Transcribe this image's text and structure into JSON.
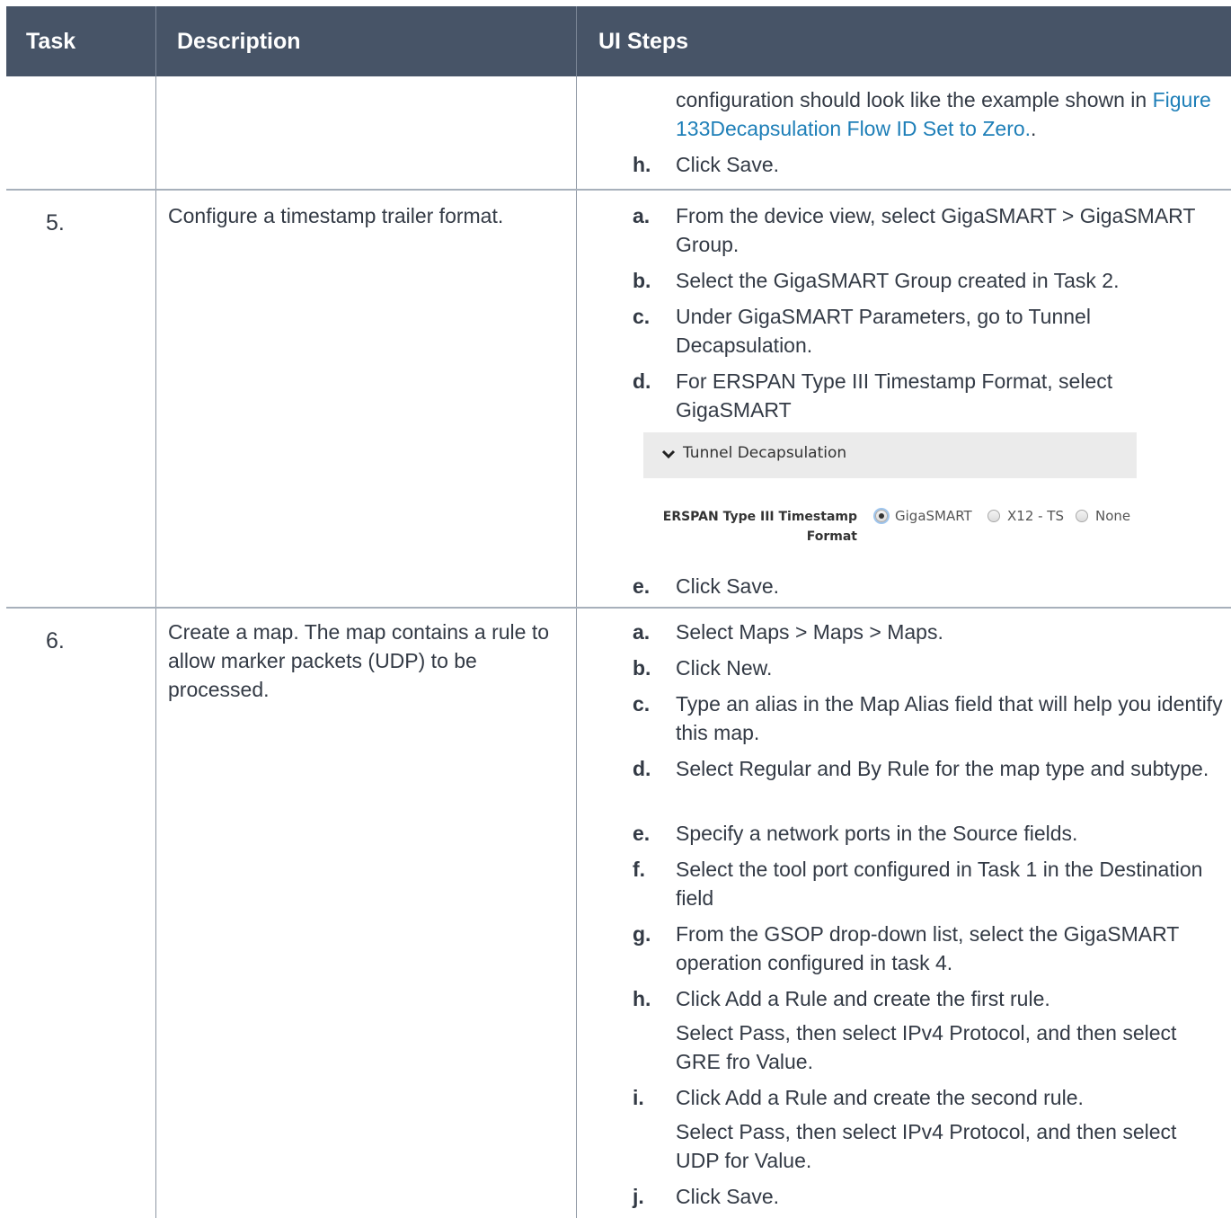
{
  "header": {
    "task": "Task",
    "description": "Description",
    "ui_steps": "UI Steps"
  },
  "continuation": {
    "text_before_link": "configuration should look like the example shown in ",
    "link": "Figure 133Decapsulation Flow ID Set to Zero.",
    "text_after_link": ".",
    "step_h": {
      "letter": "h.",
      "text": "Click Save."
    }
  },
  "row5": {
    "number": "5.",
    "description": "Configure a timestamp trailer format.",
    "steps": [
      {
        "letter": "a.",
        "text": "From the device view, select GigaSMART > GigaSMART Group."
      },
      {
        "letter": "b.",
        "text": "Select the GigaSMART Group created in Task 2."
      },
      {
        "letter": "c.",
        "text": "Under GigaSMART Parameters, go to Tunnel Decapsulation."
      },
      {
        "letter": "d.",
        "text": "For ERSPAN Type III Timestamp Format, select GigaSMART"
      }
    ],
    "screenshot": {
      "section_title": "Tunnel Decapsulation",
      "field_label": "ERSPAN Type III Timestamp Format",
      "options": [
        "GigaSMART",
        "X12 - TS",
        "None"
      ],
      "selected": "GigaSMART"
    },
    "step_e": {
      "letter": "e.",
      "text": "Click Save."
    }
  },
  "row6": {
    "number": "6.",
    "description": "Create a map. The map contains a rule to allow marker packets (UDP) to be processed.",
    "steps": [
      {
        "letter": "a.",
        "text": "Select Maps > Maps > Maps."
      },
      {
        "letter": "b.",
        "text": "Click New."
      },
      {
        "letter": "c.",
        "text": "Type an alias in the Map Alias field that will help you identify this map."
      },
      {
        "letter": "d.",
        "text": "Select Regular and By Rule for the map type and subtype."
      },
      {
        "letter": "e.",
        "text": "Specify a network ports in the Source fields."
      },
      {
        "letter": "f.",
        "text": "Select the tool port configured in Task 1 in the Destination field"
      },
      {
        "letter": "g.",
        "text": "From the GSOP drop-down list, select the GigaSMART operation configured in task 4."
      },
      {
        "letter": "h.",
        "text": "Click Add a Rule and create the first rule.",
        "sub": "Select Pass, then select IPv4 Protocol, and then select GRE fro Value."
      },
      {
        "letter": "i.",
        "text": "Click Add a Rule and create the second rule.",
        "sub": "Select Pass, then select IPv4 Protocol, and then select UDP for Value."
      },
      {
        "letter": "j.",
        "text": "Click Save."
      }
    ]
  }
}
